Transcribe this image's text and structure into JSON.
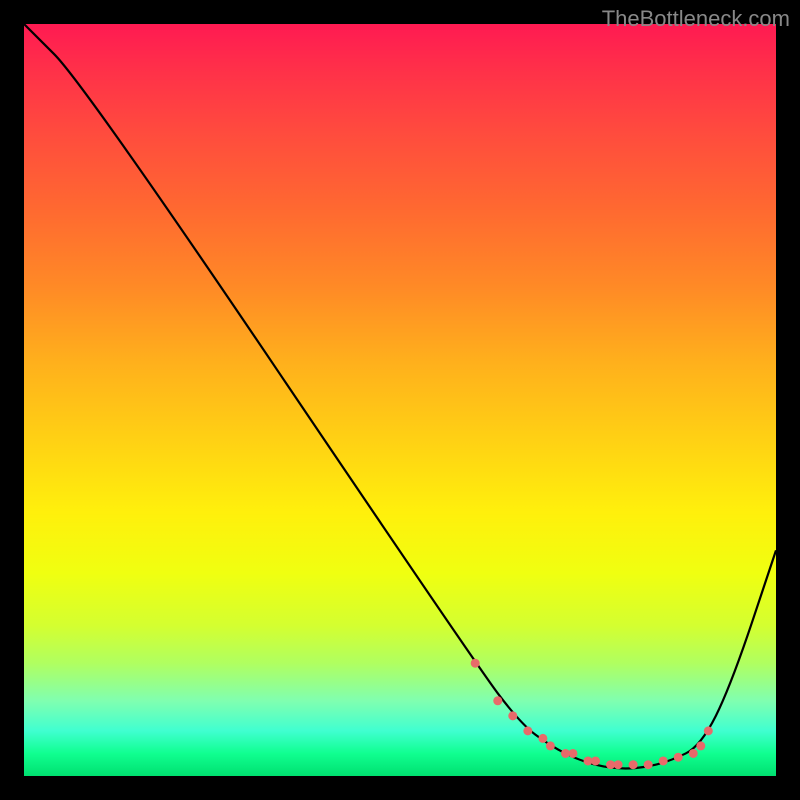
{
  "watermark": "TheBottleneck.com",
  "chart_data": {
    "type": "line",
    "title": "",
    "xlabel": "",
    "ylabel": "",
    "xlim": [
      0,
      100
    ],
    "ylim": [
      0,
      100
    ],
    "series": [
      {
        "name": "curve",
        "x": [
          0,
          8,
          60,
          66,
          70,
          74,
          78,
          82,
          86,
          90,
          94,
          100
        ],
        "y": [
          100,
          92,
          15,
          7,
          4,
          2,
          1,
          1,
          2,
          4,
          12,
          30
        ]
      }
    ],
    "markers": {
      "x": [
        60,
        63,
        65,
        67,
        69,
        70,
        72,
        73,
        75,
        76,
        78,
        79,
        81,
        83,
        85,
        87,
        89,
        90,
        91
      ],
      "y": [
        15,
        10,
        8,
        6,
        5,
        4,
        3,
        3,
        2,
        2,
        1.5,
        1.5,
        1.5,
        1.5,
        2,
        2.5,
        3,
        4,
        6
      ]
    }
  }
}
